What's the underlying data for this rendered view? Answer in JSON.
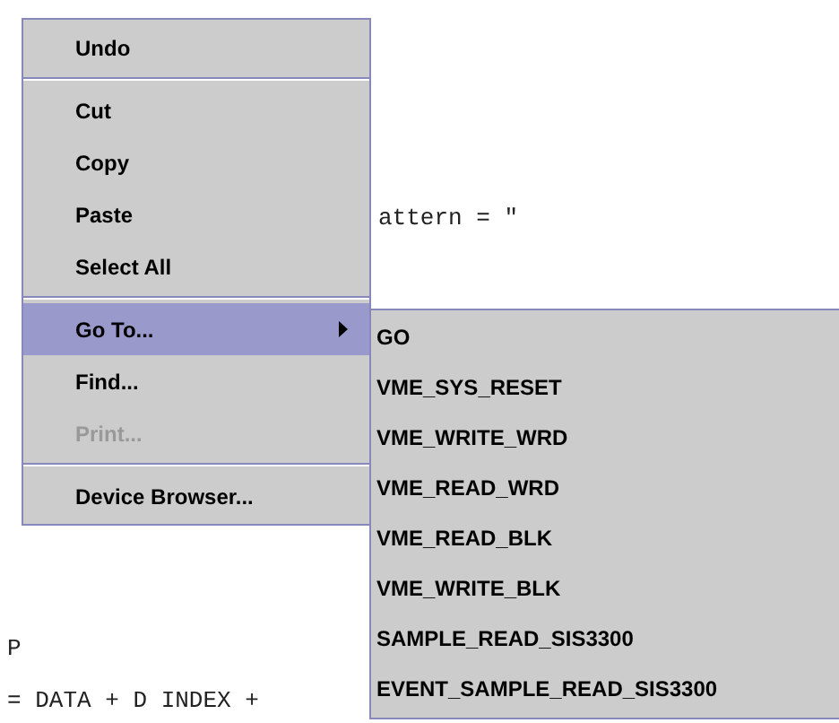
{
  "editor": {
    "lines": [
      {
        "text": "attern = \""
      },
      {
        "text": "P"
      },
      {
        "text": "= DATA + D INDEX +"
      }
    ]
  },
  "context_menu": {
    "items": [
      {
        "kind": "item",
        "label": "Undo",
        "selected": false,
        "disabled": false
      },
      {
        "kind": "separator"
      },
      {
        "kind": "item",
        "label": "Cut",
        "selected": false,
        "disabled": false
      },
      {
        "kind": "item",
        "label": "Copy",
        "selected": false,
        "disabled": false
      },
      {
        "kind": "item",
        "label": "Paste",
        "selected": false,
        "disabled": false
      },
      {
        "kind": "item",
        "label": "Select All",
        "selected": false,
        "disabled": false
      },
      {
        "kind": "separator"
      },
      {
        "kind": "submenu",
        "label": "Go To...",
        "selected": true,
        "disabled": false
      },
      {
        "kind": "item",
        "label": "Find...",
        "selected": false,
        "disabled": false
      },
      {
        "kind": "item",
        "label": "Print...",
        "selected": false,
        "disabled": true
      },
      {
        "kind": "separator"
      },
      {
        "kind": "item",
        "label": "Device Browser...",
        "selected": false,
        "disabled": false
      }
    ]
  },
  "submenu": {
    "items": [
      {
        "label": "GO"
      },
      {
        "label": "VME_SYS_RESET"
      },
      {
        "label": "VME_WRITE_WRD"
      },
      {
        "label": "VME_READ_WRD"
      },
      {
        "label": "VME_READ_BLK"
      },
      {
        "label": "VME_WRITE_BLK"
      },
      {
        "label": "SAMPLE_READ_SIS3300"
      },
      {
        "label": "EVENT_SAMPLE_READ_SIS3300"
      }
    ]
  }
}
